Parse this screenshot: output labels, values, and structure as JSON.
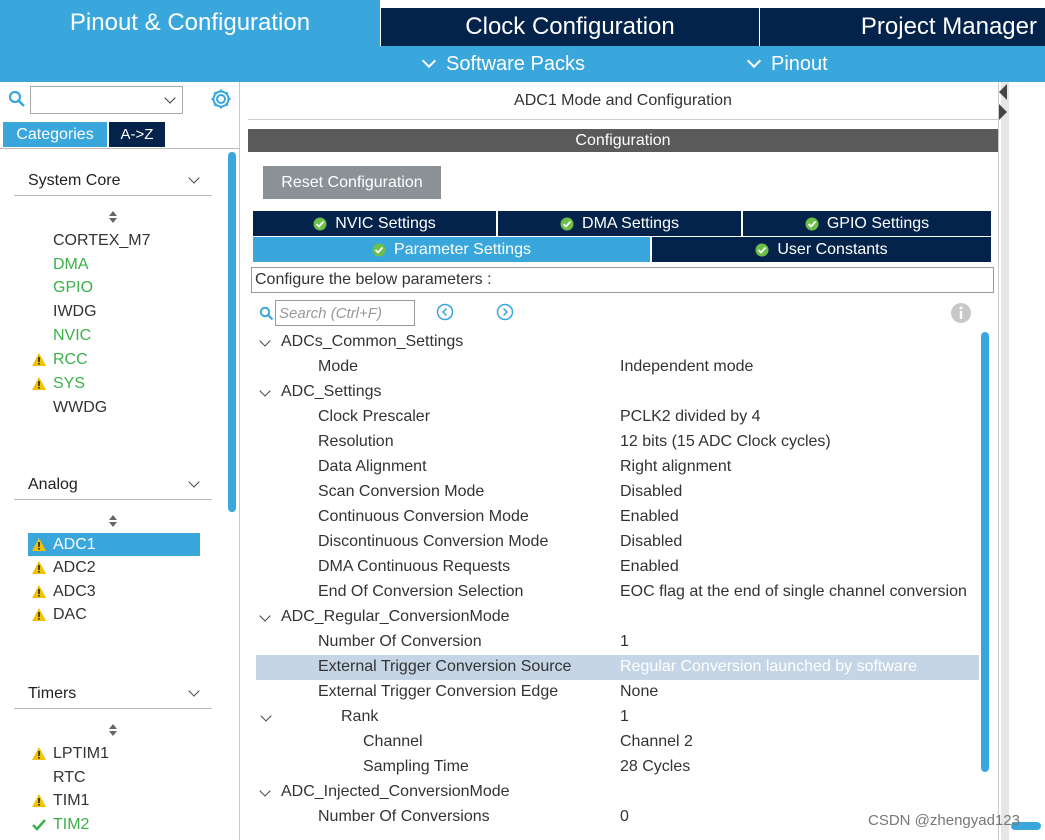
{
  "top_tabs": {
    "pinout_config": "Pinout & Configuration",
    "clock_config": "Clock Configuration",
    "project_manager": "Project Manager"
  },
  "sub_menu": {
    "software_packs": "Software Packs",
    "pinout": "Pinout"
  },
  "sidebar": {
    "search_value": "",
    "tab_categories": "Categories",
    "tab_az": "A->Z",
    "groups": [
      {
        "title": "System Core",
        "items": [
          {
            "label": "CORTEX_M7",
            "status": "none"
          },
          {
            "label": "DMA",
            "status": "configured"
          },
          {
            "label": "GPIO",
            "status": "configured"
          },
          {
            "label": "IWDG",
            "status": "none"
          },
          {
            "label": "NVIC",
            "status": "configured"
          },
          {
            "label": "RCC",
            "status": "warning"
          },
          {
            "label": "SYS",
            "status": "warning"
          },
          {
            "label": "WWDG",
            "status": "none"
          }
        ]
      },
      {
        "title": "Analog",
        "items": [
          {
            "label": "ADC1",
            "status": "warning-selected"
          },
          {
            "label": "ADC2",
            "status": "warning"
          },
          {
            "label": "ADC3",
            "status": "warning"
          },
          {
            "label": "DAC",
            "status": "warning"
          }
        ]
      },
      {
        "title": "Timers",
        "items": [
          {
            "label": "LPTIM1",
            "status": "warning"
          },
          {
            "label": "RTC",
            "status": "none"
          },
          {
            "label": "TIM1",
            "status": "warning"
          },
          {
            "label": "TIM2",
            "status": "ok"
          }
        ]
      }
    ]
  },
  "main": {
    "mode_title": "ADC1 Mode and Configuration",
    "config_header": "Configuration",
    "reset_button": "Reset Configuration",
    "tabs": {
      "nvic": "NVIC Settings",
      "dma": "DMA Settings",
      "gpio": "GPIO Settings",
      "parameter": "Parameter Settings",
      "user_constants": "User Constants"
    },
    "configure_label": "Configure the below parameters :",
    "search_placeholder": "Search (Ctrl+F)",
    "params": [
      {
        "name": "ADCs_Common_Settings",
        "value": "",
        "level": 0,
        "group": true
      },
      {
        "name": "Mode",
        "value": "Independent mode",
        "level": 1
      },
      {
        "name": "ADC_Settings",
        "value": "",
        "level": 0,
        "group": true
      },
      {
        "name": "Clock Prescaler",
        "value": "PCLK2 divided by 4",
        "level": 1
      },
      {
        "name": "Resolution",
        "value": "12 bits (15 ADC Clock cycles)",
        "level": 1
      },
      {
        "name": "Data Alignment",
        "value": "Right alignment",
        "level": 1
      },
      {
        "name": "Scan Conversion Mode",
        "value": "Disabled",
        "level": 1
      },
      {
        "name": "Continuous Conversion Mode",
        "value": "Enabled",
        "level": 1
      },
      {
        "name": "Discontinuous Conversion Mode",
        "value": "Disabled",
        "level": 1
      },
      {
        "name": "DMA Continuous Requests",
        "value": "Enabled",
        "level": 1
      },
      {
        "name": "End Of Conversion Selection",
        "value": "EOC flag at the end of single channel conversion",
        "level": 1
      },
      {
        "name": "ADC_Regular_ConversionMode",
        "value": "",
        "level": 0,
        "group": true
      },
      {
        "name": "Number Of Conversion",
        "value": "1",
        "level": 1
      },
      {
        "name": "External Trigger Conversion Source",
        "value": "Regular Conversion launched by software",
        "level": 1,
        "selected": true
      },
      {
        "name": "External Trigger Conversion Edge",
        "value": "None",
        "level": 1
      },
      {
        "name": "Rank",
        "value": "1",
        "level": 2,
        "group": true
      },
      {
        "name": "Channel",
        "value": "Channel 2",
        "level": 3
      },
      {
        "name": "Sampling Time",
        "value": "28 Cycles",
        "level": 3
      },
      {
        "name": "ADC_Injected_ConversionMode",
        "value": "",
        "level": 0,
        "group": true
      },
      {
        "name": "Number Of Conversions",
        "value": "0",
        "level": 1
      }
    ]
  },
  "watermark": "CSDN @zhengyad123",
  "colors": {
    "accent_blue": "#39a6dc",
    "navy": "#03234b",
    "green": "#3bb04a",
    "warning_yellow": "#f2c200",
    "selected_row": "#c5d5e6"
  }
}
